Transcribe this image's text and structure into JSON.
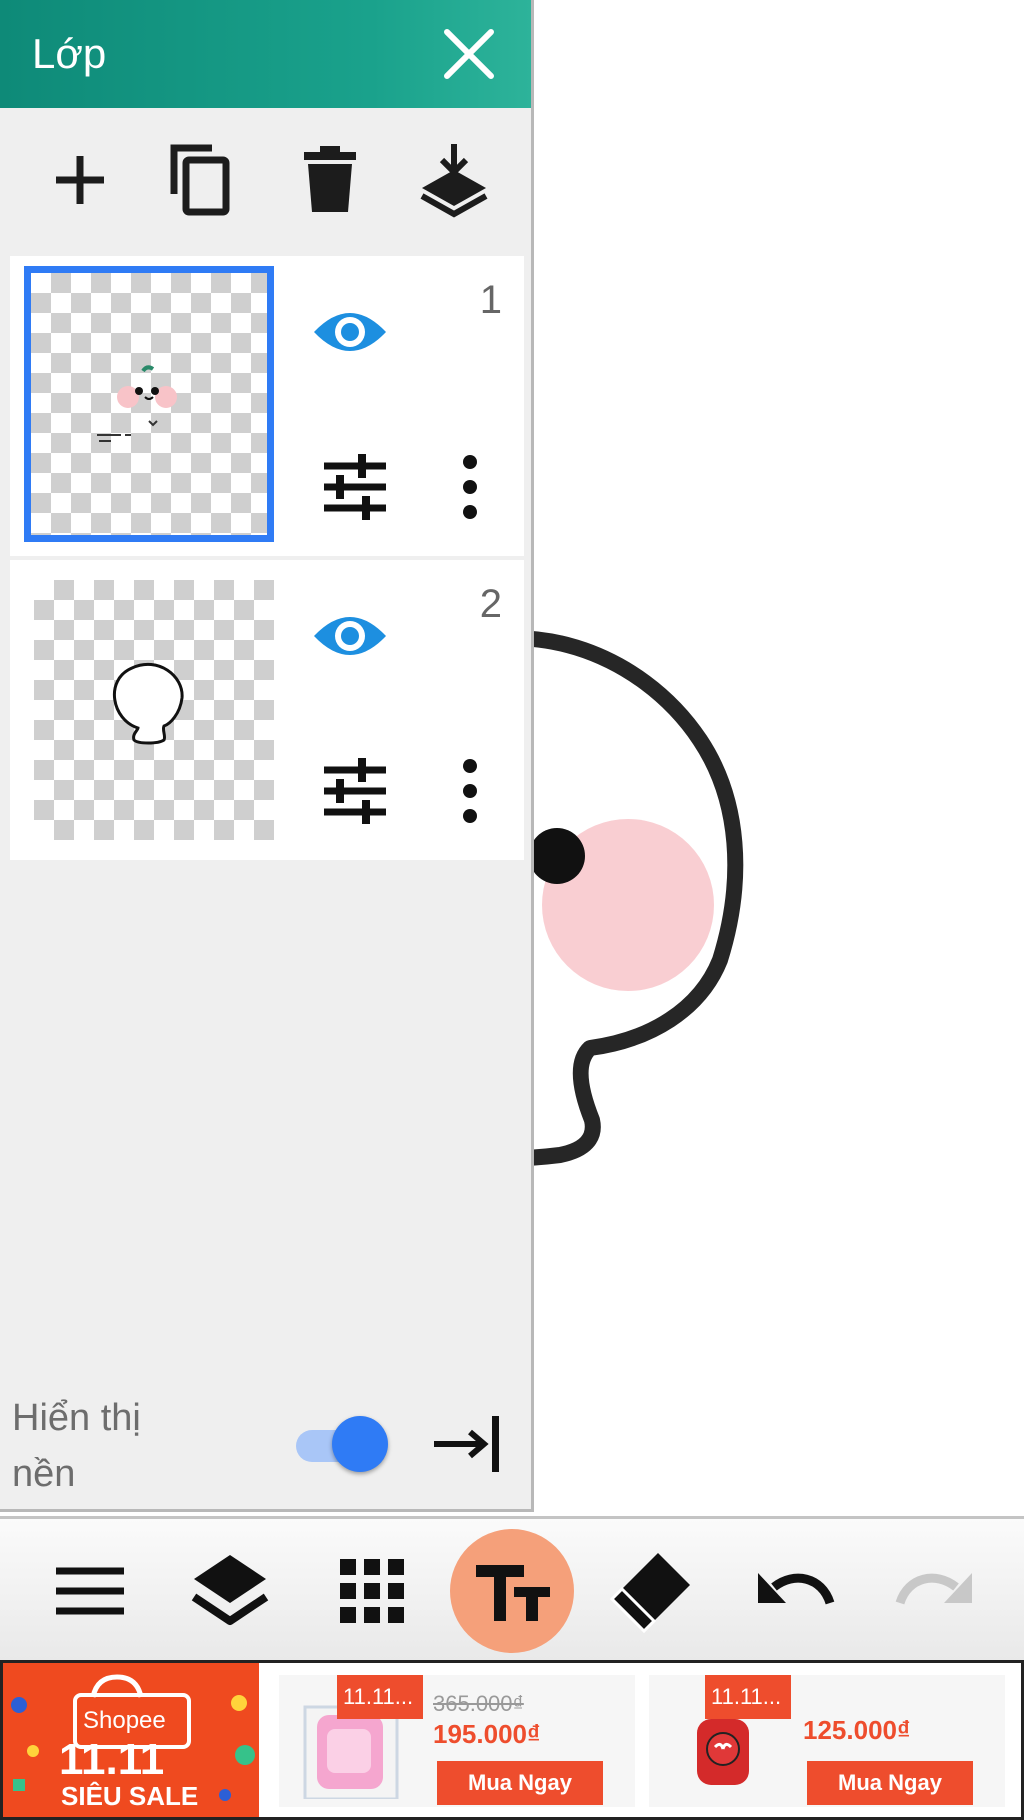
{
  "panel": {
    "title": "Lớp",
    "layers": [
      {
        "number": "1",
        "selected": true,
        "visible": true
      },
      {
        "number": "2",
        "selected": false,
        "visible": true
      }
    ],
    "background_label": "Hiển thị nền",
    "background_visible": true
  },
  "toolbar_icons": [
    "add-layer-icon",
    "duplicate-layer-icon",
    "delete-layer-icon",
    "merge-down-icon"
  ],
  "bottom_bar_icons": [
    "menu-icon",
    "layers-icon",
    "grid-icon",
    "text-icon",
    "eraser-icon",
    "undo-icon",
    "redo-icon"
  ],
  "ad": {
    "logo_brand": "Shopee",
    "logo_date": "11.11",
    "logo_sale": "SIÊU SALE",
    "cards": [
      {
        "tag": "11.11...",
        "old_price": "365.000₫",
        "price": "195.000₫",
        "button": "Mua Ngay"
      },
      {
        "tag": "11.11...",
        "price": "125.000₫",
        "button": "Mua Ngay"
      }
    ]
  },
  "colors": {
    "header_teal": "#129783",
    "selection_blue": "#2f7bf5",
    "eye_blue": "#1d8fe0",
    "text_tool_active": "#f5a07a",
    "shopee_orange": "#ee4d2d"
  }
}
